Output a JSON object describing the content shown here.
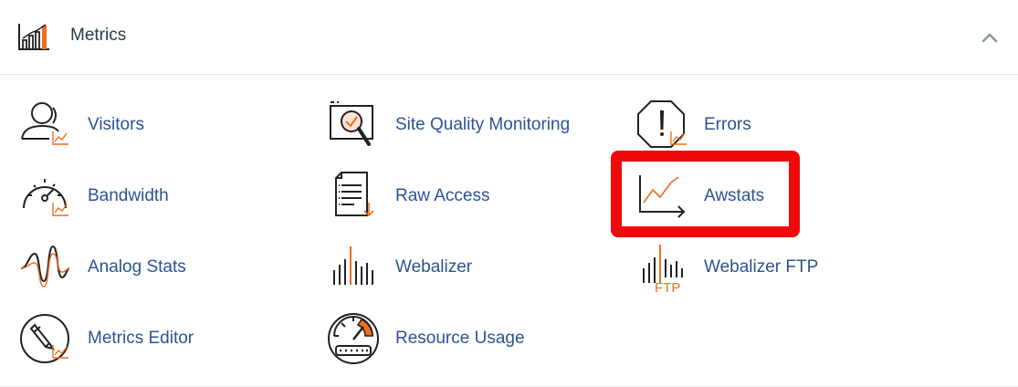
{
  "header": {
    "title": "Metrics"
  },
  "items": [
    {
      "label": "Visitors",
      "icon": "visitors-icon"
    },
    {
      "label": "Site Quality Monitoring",
      "icon": "site-quality-icon"
    },
    {
      "label": "Errors",
      "icon": "errors-icon"
    },
    {
      "label": "Bandwidth",
      "icon": "bandwidth-icon"
    },
    {
      "label": "Raw Access",
      "icon": "raw-access-icon"
    },
    {
      "label": "Awstats",
      "icon": "awstats-icon"
    },
    {
      "label": "Analog Stats",
      "icon": "analog-stats-icon"
    },
    {
      "label": "Webalizer",
      "icon": "webalizer-icon"
    },
    {
      "label": "Webalizer FTP",
      "icon": "webalizer-ftp-icon",
      "icon_text": "FTP"
    },
    {
      "label": "Metrics Editor",
      "icon": "metrics-editor-icon"
    },
    {
      "label": "Resource Usage",
      "icon": "resource-usage-icon"
    }
  ],
  "colors": {
    "label": "#2d5391",
    "accent": "#f36c21",
    "highlight": "#ee0a0a",
    "icon": "#222222"
  }
}
